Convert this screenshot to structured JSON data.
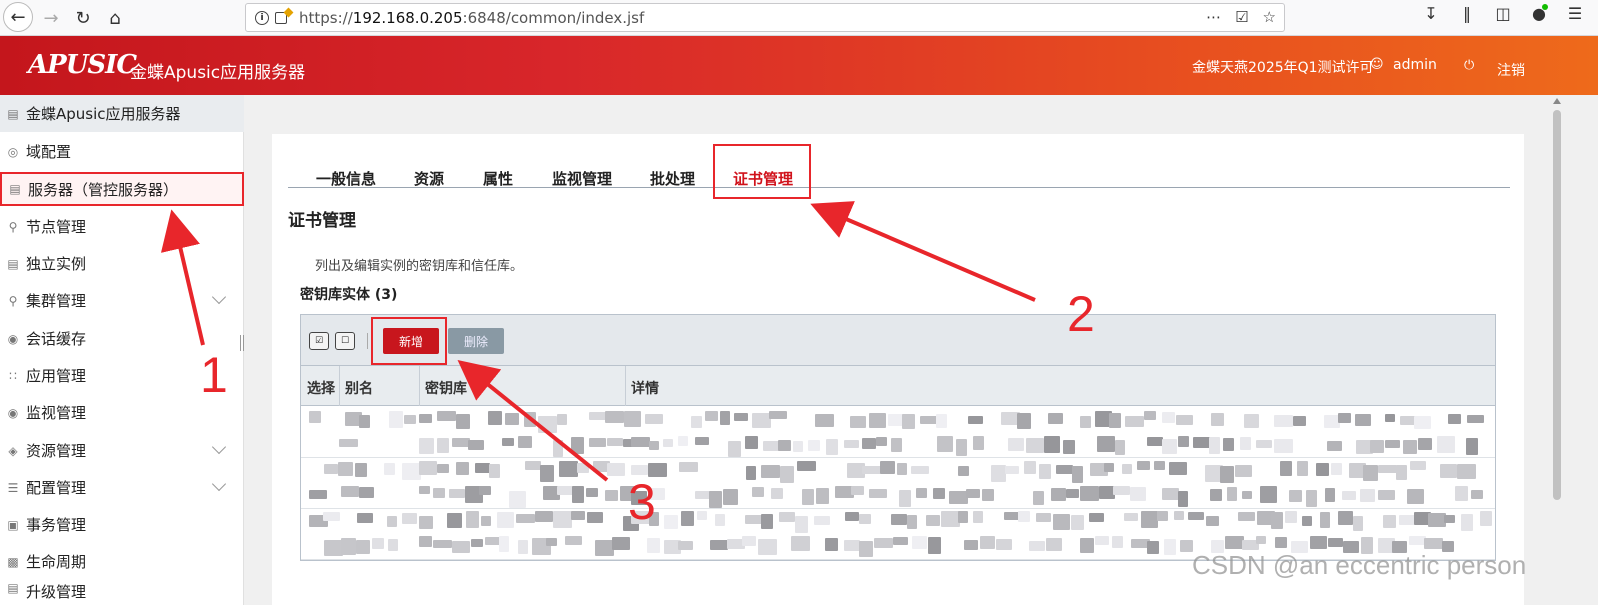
{
  "browser": {
    "url_prefix": "https://",
    "url_host": "192.168.0.205",
    "url_rest": ":6848/common/index.jsf"
  },
  "header": {
    "logo": "APUSIC",
    "title": "金蝶Apusic应用服务器",
    "license": "金蝶天燕2025年Q1测试许可",
    "user": "admin",
    "logout": "注销"
  },
  "sidebar": {
    "items": [
      {
        "label": "金蝶Apusic应用服务器",
        "icon": "calendar-icon"
      },
      {
        "label": "域配置",
        "icon": "globe-icon"
      },
      {
        "label": "服务器（管控服务器）",
        "icon": "server-icon"
      },
      {
        "label": "节点管理",
        "icon": "nodes-icon"
      },
      {
        "label": "独立实例",
        "icon": "list-icon"
      },
      {
        "label": "集群管理",
        "icon": "cluster-icon"
      },
      {
        "label": "会话缓存",
        "icon": "session-icon"
      },
      {
        "label": "应用管理",
        "icon": "apps-icon"
      },
      {
        "label": "监视管理",
        "icon": "monitor-icon"
      },
      {
        "label": "资源管理",
        "icon": "layers-icon"
      },
      {
        "label": "配置管理",
        "icon": "sliders-icon"
      },
      {
        "label": "事务管理",
        "icon": "phone-icon"
      },
      {
        "label": "生命周期",
        "icon": "chart-icon"
      },
      {
        "label": "升级管理",
        "icon": "upgrade-icon"
      }
    ]
  },
  "tabs": [
    "一般信息",
    "资源",
    "属性",
    "监视管理",
    "批处理",
    "证书管理"
  ],
  "page": {
    "title": "证书管理",
    "description": "列出及编辑实例的密钥库和信任库。",
    "section": "密钥库实体 (3)"
  },
  "toolbar": {
    "add": "新增",
    "delete": "删除"
  },
  "table": {
    "columns": [
      "选择",
      "别名",
      "密钥库",
      "详情"
    ]
  },
  "annotations": [
    "1",
    "2",
    "3"
  ],
  "watermark": "CSDN @an eccentric person",
  "colors": {
    "accent": "#c8161d",
    "highlight": "#e8262b"
  }
}
